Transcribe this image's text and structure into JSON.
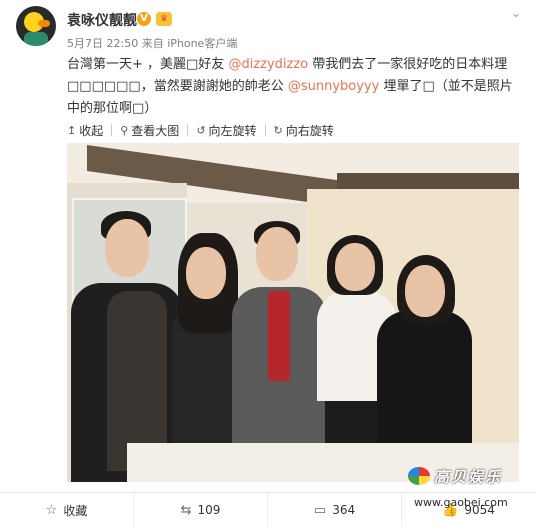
{
  "post": {
    "username": "袁咏仪靓靓",
    "verified_badge": "V",
    "member_badge": "♛",
    "timestamp": "5月7日 22:50",
    "source": "来自 iPhone客户端",
    "dropdown_icon": "chevron-down-icon",
    "text_parts": {
      "p1": "台灣第一天+ ，美麗□好友 ",
      "m1": "@dizzydizzo",
      "p2": " 帶我們去了一家很好吃的日本料理□□□□□□，當然要謝謝她的帥老公 ",
      "m2": "@sunnyboyyy",
      "p3": " 埋單了□（並不是照片中的那位啊□）"
    },
    "accent_color": "#eb7350"
  },
  "media_bar": {
    "collapse": "收起",
    "view_large": "查看大图",
    "rotate_left": "向左旋转",
    "rotate_right": "向右旋转"
  },
  "watermark": {
    "logo_text": "高贝娱乐",
    "url": "www.gaobei.com"
  },
  "footer": {
    "favorite": "收藏",
    "reposts": "109",
    "comments": "364",
    "likes": "9054"
  }
}
